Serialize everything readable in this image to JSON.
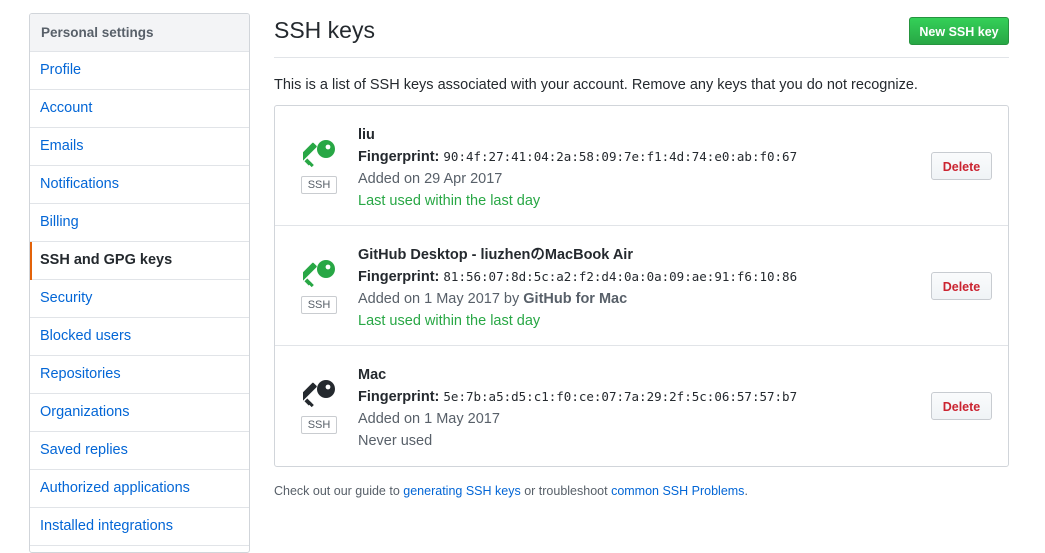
{
  "sidebar": {
    "header": "Personal settings",
    "items": [
      {
        "label": "Profile"
      },
      {
        "label": "Account"
      },
      {
        "label": "Emails"
      },
      {
        "label": "Notifications"
      },
      {
        "label": "Billing"
      },
      {
        "label": "SSH and GPG keys",
        "selected": true
      },
      {
        "label": "Security"
      },
      {
        "label": "Blocked users"
      },
      {
        "label": "Repositories"
      },
      {
        "label": "Organizations"
      },
      {
        "label": "Saved replies"
      },
      {
        "label": "Authorized applications"
      },
      {
        "label": "Installed integrations"
      }
    ]
  },
  "main": {
    "title": "SSH keys",
    "new_key_label": "New SSH key",
    "intro": "This is a list of SSH keys associated with your account. Remove any keys that you do not recognize.",
    "keys": [
      {
        "title": "liu",
        "fingerprint_label": "Fingerprint:",
        "fingerprint": "90:4f:27:41:04:2a:58:09:7e:f1:4d:74:e0:ab:f0:67",
        "added": "Added on 29 Apr 2017",
        "usage": "Last used within the last day",
        "type_label": "SSH",
        "icon_color": "#28a745",
        "delete_label": "Delete"
      },
      {
        "title": "GitHub Desktop - liuzhenのMacBook Air",
        "fingerprint_label": "Fingerprint:",
        "fingerprint": "81:56:07:8d:5c:a2:f2:d4:0a:0a:09:ae:91:f6:10:86",
        "added": "Added on 1 May 2017 by",
        "added_by": "GitHub for Mac",
        "usage": "Last used within the last day",
        "type_label": "SSH",
        "icon_color": "#28a745",
        "delete_label": "Delete"
      },
      {
        "title": "Mac",
        "fingerprint_label": "Fingerprint:",
        "fingerprint": "5e:7b:a5:d5:c1:f0:ce:07:7a:29:2f:5c:06:57:57:b7",
        "added": "Added on 1 May 2017",
        "usage": "Never used",
        "type_label": "SSH",
        "icon_color": "#24292e",
        "delete_label": "Delete"
      }
    ],
    "footer": {
      "prefix": "Check out our guide to",
      "link1": "generating SSH keys",
      "middle": "or troubleshoot",
      "link2": "common SSH Problems",
      "suffix": "."
    }
  },
  "colors": {
    "accent": "#0366d6",
    "selected_marker": "#e36209",
    "primary_button": "#28a745",
    "danger": "#cb2431"
  },
  "icons": {
    "key": "key-icon"
  }
}
